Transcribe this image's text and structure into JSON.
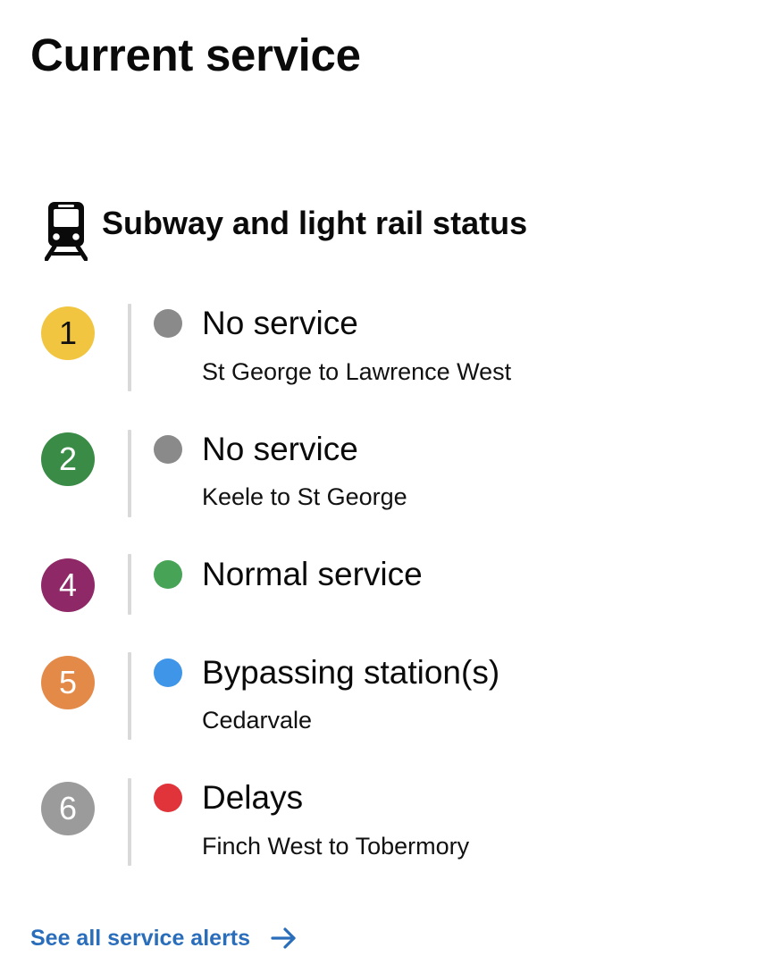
{
  "page": {
    "title": "Current service"
  },
  "section": {
    "title": "Subway and light rail status",
    "icon": "subway-train-icon"
  },
  "lines": [
    {
      "number": "1",
      "badge_color": "#f1c540",
      "badge_text_color": "#111111",
      "status": "No service",
      "status_color": "#8a8a8a",
      "detail": "St George to Lawrence West"
    },
    {
      "number": "2",
      "badge_color": "#3a8b46",
      "badge_text_color": "#ffffff",
      "status": "No service",
      "status_color": "#8a8a8a",
      "detail": "Keele to St George"
    },
    {
      "number": "4",
      "badge_color": "#8e2866",
      "badge_text_color": "#ffffff",
      "status": "Normal service",
      "status_color": "#47a456",
      "detail": ""
    },
    {
      "number": "5",
      "badge_color": "#e48a49",
      "badge_text_color": "#ffffff",
      "status": "Bypassing station(s)",
      "status_color": "#3f95e8",
      "detail": "Cedarvale"
    },
    {
      "number": "6",
      "badge_color": "#9b9b9b",
      "badge_text_color": "#ffffff",
      "status": "Delays",
      "status_color": "#e1343a",
      "detail": "Finch West to Tobermory"
    }
  ],
  "footer": {
    "link_label": "See all service alerts",
    "link_icon": "arrow-right-icon",
    "link_color": "#2a6ebb"
  }
}
